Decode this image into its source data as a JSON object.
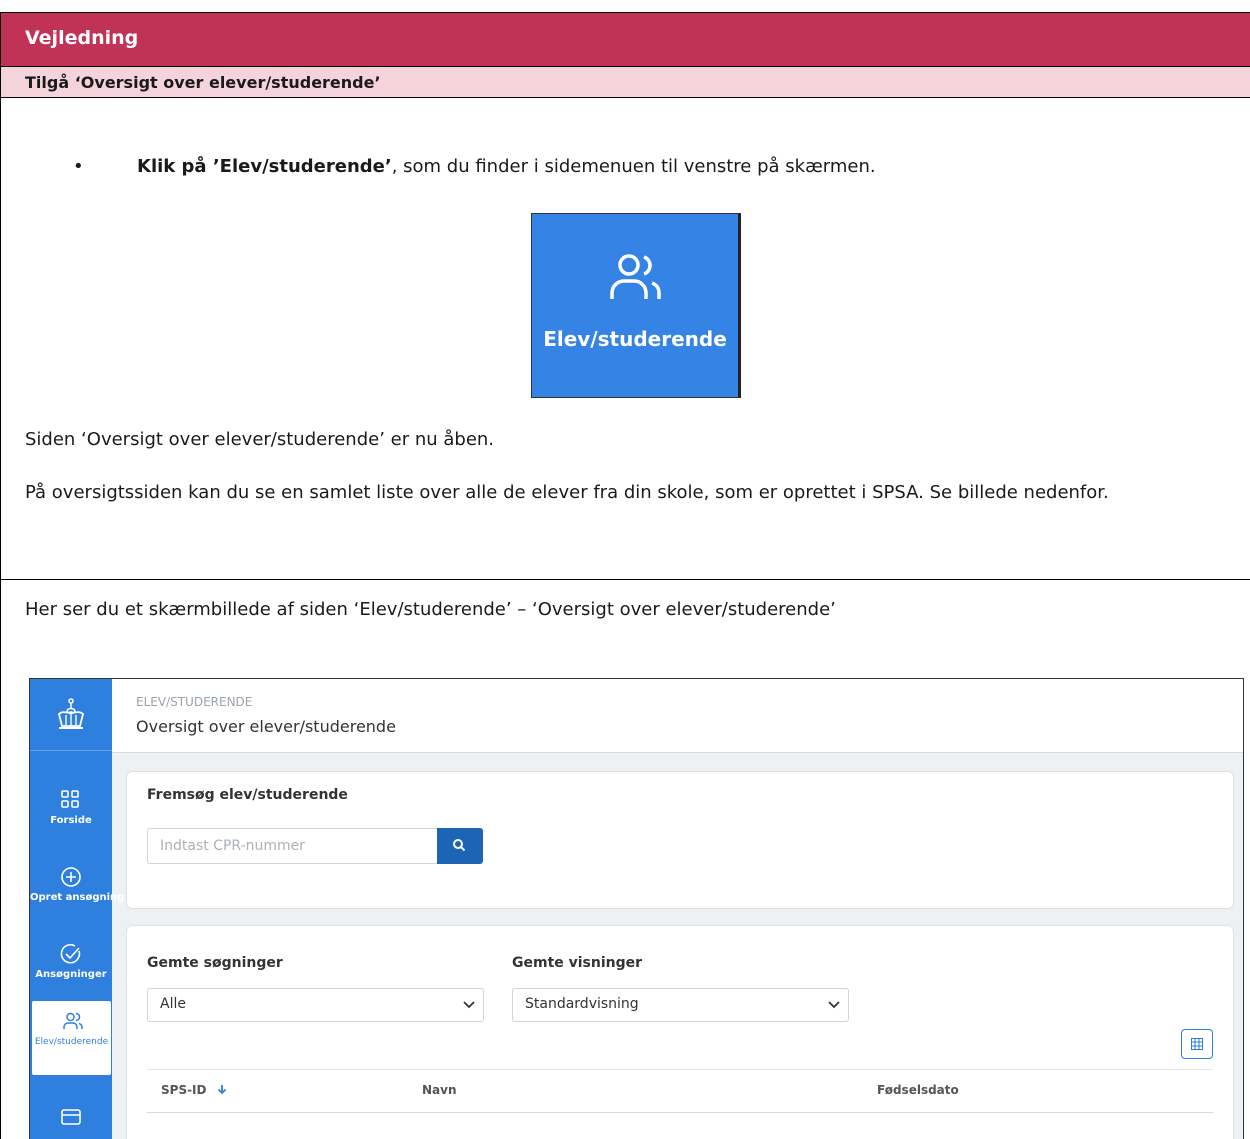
{
  "header": {
    "title": "Vejledning"
  },
  "subheader": {
    "title": "Tilgå ‘Oversigt over elever/studerende’"
  },
  "instruction": {
    "bullet": "•",
    "bold": "Klik på ’Elev/studerende’",
    "rest": ", som du finder i sidemenuen til venstre på skærmen."
  },
  "nav_tile": {
    "label": "Elev/studerende",
    "icon": "users-icon",
    "color": "#3583e4"
  },
  "paragraphs": {
    "p1": "Siden ‘Oversigt over elever/studerende’ er nu åben.",
    "p2": "På oversigtssiden kan du se en samlet liste over alle de elever fra din skole, som er oprettet i SPSA. Se billede nedenfor."
  },
  "section2": {
    "text": "Her ser du et skærmbillede af siden ‘Elev/studerende’ – ‘Oversigt over elever/studerende’"
  },
  "screenshot": {
    "sidebar": [
      {
        "label": "Forside",
        "icon": "grid-icon"
      },
      {
        "label": "Opret ansøgning",
        "icon": "plus-circle-icon"
      },
      {
        "label": "Ansøgninger",
        "icon": "check-circle-icon"
      },
      {
        "label": "Elev/studerende",
        "icon": "users-icon"
      }
    ],
    "breadcrumb": "ELEV/STUDERENDE",
    "page_title": "Oversigt over elever/studerende",
    "search_card": {
      "title": "Fremsøg elev/studerende",
      "placeholder": "Indtast CPR-nummer"
    },
    "filters": {
      "saved_searches_label": "Gemte søgninger",
      "saved_searches_value": "Alle",
      "saved_views_label": "Gemte visninger",
      "saved_views_value": "Standardvisning"
    },
    "table_headers": [
      "SPS-ID",
      "Navn",
      "Fødselsdato"
    ]
  }
}
